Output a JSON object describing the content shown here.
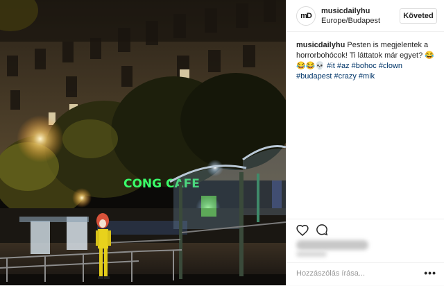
{
  "header": {
    "username": "musicdailyhu",
    "location": "Europe/Budapest",
    "follow_label": "Követed",
    "avatar_text": "mD"
  },
  "caption": {
    "username": "musicdailyhu",
    "text": "Pesten is megjelentek a horrorbohócok! Ti láttatok már egyet? 😂😂😂💀 #it #az #bohoc #clown #budapest #crazy #mik"
  },
  "photo": {
    "neon_sign": "CONG CAFE",
    "description_icon": "photo"
  },
  "actions": {
    "like_icon": "heart-icon",
    "comment_icon": "comment-icon"
  },
  "comment": {
    "placeholder": "Hozzászólás írása...",
    "more_label": "•••"
  },
  "colors": {
    "hashtag": "#003569",
    "border": "#efefef",
    "text": "#262626",
    "neon": "#39ff6a"
  }
}
